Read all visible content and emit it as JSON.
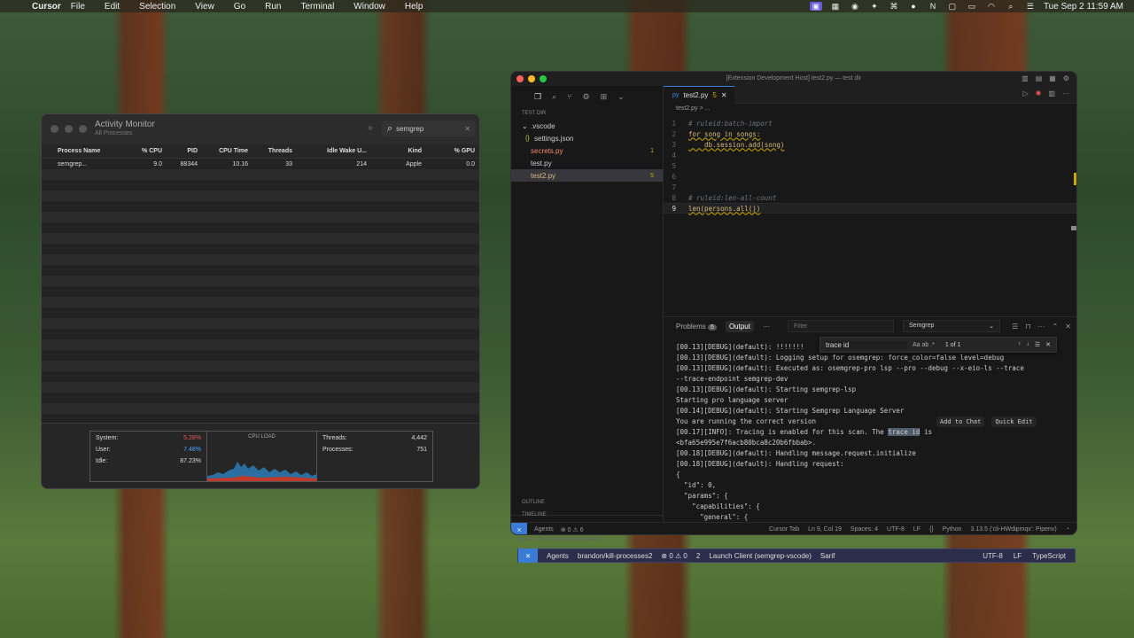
{
  "menubar": {
    "app": "Cursor",
    "items": [
      "File",
      "Edit",
      "Selection",
      "View",
      "Go",
      "Run",
      "Terminal",
      "Window",
      "Help"
    ],
    "datetime": "Tue Sep 2  11:59 AM"
  },
  "activity_monitor": {
    "title": "Activity Monitor",
    "subtitle": "All Processes",
    "search_value": "semgrep",
    "columns": [
      "Process Name",
      "% CPU",
      "PID",
      "CPU Time",
      "Threads",
      "Idle Wake U...",
      "Kind",
      "% GPU"
    ],
    "rows": [
      [
        "semgrep...",
        "9.0",
        "88344",
        "10.16",
        "33",
        "214",
        "Apple",
        "0.0"
      ]
    ],
    "cpu": {
      "system_label": "System:",
      "system_value": "5.28%",
      "user_label": "User:",
      "user_value": "7.48%",
      "idle_label": "Idle:",
      "idle_value": "87.23%",
      "graph_label": "CPU LOAD",
      "threads_label": "Threads:",
      "threads_value": "4,442",
      "processes_label": "Processes:",
      "processes_value": "751"
    }
  },
  "cursor": {
    "window_title": "[Extension Development Host] test2.py — test dir",
    "explorer": {
      "section": "TEST DIR",
      "items": [
        {
          "name": ".vscode",
          "count": ""
        },
        {
          "name": "settings.json",
          "count": ""
        },
        {
          "name": "secrets.py",
          "count": "1"
        },
        {
          "name": "test.py",
          "count": ""
        },
        {
          "name": "test2.py",
          "count": "5"
        }
      ],
      "outline": "OUTLINE",
      "timeline": "TIMELINE"
    },
    "tab": {
      "icon": "py",
      "label": "test2.py",
      "badge": "5"
    },
    "breadcrumb": "test2.py > ...",
    "code_lines": [
      {
        "n": "1",
        "text": "# ruleid:batch-import"
      },
      {
        "n": "2",
        "text": "for song in songs:"
      },
      {
        "n": "3",
        "text": "    db.session.add(song)"
      },
      {
        "n": "4",
        "text": ""
      },
      {
        "n": "5",
        "text": ""
      },
      {
        "n": "6",
        "text": ""
      },
      {
        "n": "7",
        "text": ""
      },
      {
        "n": "8",
        "text": "# ruleid:len-all-count"
      },
      {
        "n": "9",
        "text": "len(persons.all())"
      }
    ],
    "panel": {
      "problems_label": "Problems",
      "problems_count": "6",
      "output_label": "Output",
      "more": "···",
      "filter_placeholder": "Filter",
      "channel": "Semgrep",
      "find_value": "trace id",
      "find_opts": "Aa  ab  .*",
      "find_result": "1 of 1",
      "add_to_chat": "Add to Chat",
      "quick_edit": "Quick Edit",
      "lines": [
        "[00.13][DEBUG](default): !!!!!!!",
        "[00.13][DEBUG](default): Logging setup for osemgrep: force_color=false level=debug",
        "[00.13][DEBUG](default): Executed as: osemgrep-pro lsp --pro --debug --x-eio-ls --trace",
        "--trace-endpoint semgrep-dev",
        "[00.13][DEBUG](default): Starting semgrep-lsp",
        "Starting pro language server",
        "[00.14][DEBUG](default): Starting Semgrep Language Server",
        "You are running the correct version",
        "[00.17][INFO]: Tracing is enabled for this scan. The trace id is",
        "<bfa65e995e7f6acb80bca8c20b6fbbab>.",
        "[00.18][DEBUG](default): Handling message.request.initialize",
        "[00.18][DEBUG](default): Handling request:",
        "{",
        "  \"id\": 0,",
        "  \"params\": {",
        "    \"capabilities\": {",
        "      \"general\": {"
      ]
    },
    "status": {
      "agents": "Agents",
      "problems": "⊗ 0 ⚠ 6",
      "cursor_tab": "Cursor Tab",
      "position": "Ln 9, Col 19",
      "spaces": "Spaces: 4",
      "encoding": "UTF-8",
      "eol": "LF",
      "braces": "{}",
      "language": "Python",
      "interpreter": "3.13.5 ('cli-HWdipmqx': Pipenv)"
    }
  },
  "host_bar": {
    "breakpoints": "EVENT LISTENER BREAKPOINTS",
    "agents": "Agents",
    "branch": "brandon/kill-processes2",
    "problems": "⊗ 0 ⚠ 0",
    "ports": "2",
    "launch": "Launch Client (semgrep-vscode)",
    "sarif": "Sarif",
    "encoding": "UTF-8",
    "eol": "LF",
    "language": "TypeScript"
  },
  "colors": {
    "accent": "#3a7bd5",
    "warning": "#cca700",
    "error": "#f48771",
    "host_bar": "#2b2d4a"
  }
}
